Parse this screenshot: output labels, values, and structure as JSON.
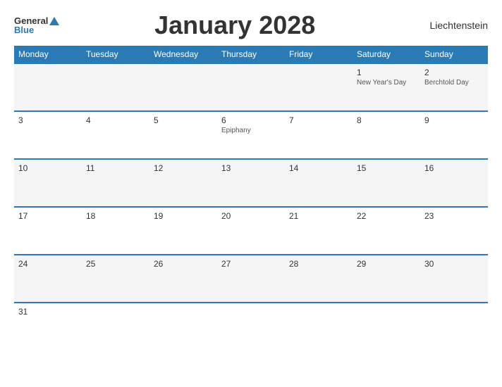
{
  "header": {
    "logo_general": "General",
    "logo_blue": "Blue",
    "title": "January 2028",
    "country": "Liechtenstein"
  },
  "calendar": {
    "days_of_week": [
      "Monday",
      "Tuesday",
      "Wednesday",
      "Thursday",
      "Friday",
      "Saturday",
      "Sunday"
    ],
    "weeks": [
      [
        {
          "date": "",
          "holiday": ""
        },
        {
          "date": "",
          "holiday": ""
        },
        {
          "date": "",
          "holiday": ""
        },
        {
          "date": "",
          "holiday": ""
        },
        {
          "date": "",
          "holiday": ""
        },
        {
          "date": "1",
          "holiday": "New Year's Day"
        },
        {
          "date": "2",
          "holiday": "Berchtold Day"
        }
      ],
      [
        {
          "date": "3",
          "holiday": ""
        },
        {
          "date": "4",
          "holiday": ""
        },
        {
          "date": "5",
          "holiday": ""
        },
        {
          "date": "6",
          "holiday": "Epiphany"
        },
        {
          "date": "7",
          "holiday": ""
        },
        {
          "date": "8",
          "holiday": ""
        },
        {
          "date": "9",
          "holiday": ""
        }
      ],
      [
        {
          "date": "10",
          "holiday": ""
        },
        {
          "date": "11",
          "holiday": ""
        },
        {
          "date": "12",
          "holiday": ""
        },
        {
          "date": "13",
          "holiday": ""
        },
        {
          "date": "14",
          "holiday": ""
        },
        {
          "date": "15",
          "holiday": ""
        },
        {
          "date": "16",
          "holiday": ""
        }
      ],
      [
        {
          "date": "17",
          "holiday": ""
        },
        {
          "date": "18",
          "holiday": ""
        },
        {
          "date": "19",
          "holiday": ""
        },
        {
          "date": "20",
          "holiday": ""
        },
        {
          "date": "21",
          "holiday": ""
        },
        {
          "date": "22",
          "holiday": ""
        },
        {
          "date": "23",
          "holiday": ""
        }
      ],
      [
        {
          "date": "24",
          "holiday": ""
        },
        {
          "date": "25",
          "holiday": ""
        },
        {
          "date": "26",
          "holiday": ""
        },
        {
          "date": "27",
          "holiday": ""
        },
        {
          "date": "28",
          "holiday": ""
        },
        {
          "date": "29",
          "holiday": ""
        },
        {
          "date": "30",
          "holiday": ""
        }
      ],
      [
        {
          "date": "31",
          "holiday": ""
        },
        {
          "date": "",
          "holiday": ""
        },
        {
          "date": "",
          "holiday": ""
        },
        {
          "date": "",
          "holiday": ""
        },
        {
          "date": "",
          "holiday": ""
        },
        {
          "date": "",
          "holiday": ""
        },
        {
          "date": "",
          "holiday": ""
        }
      ]
    ]
  }
}
